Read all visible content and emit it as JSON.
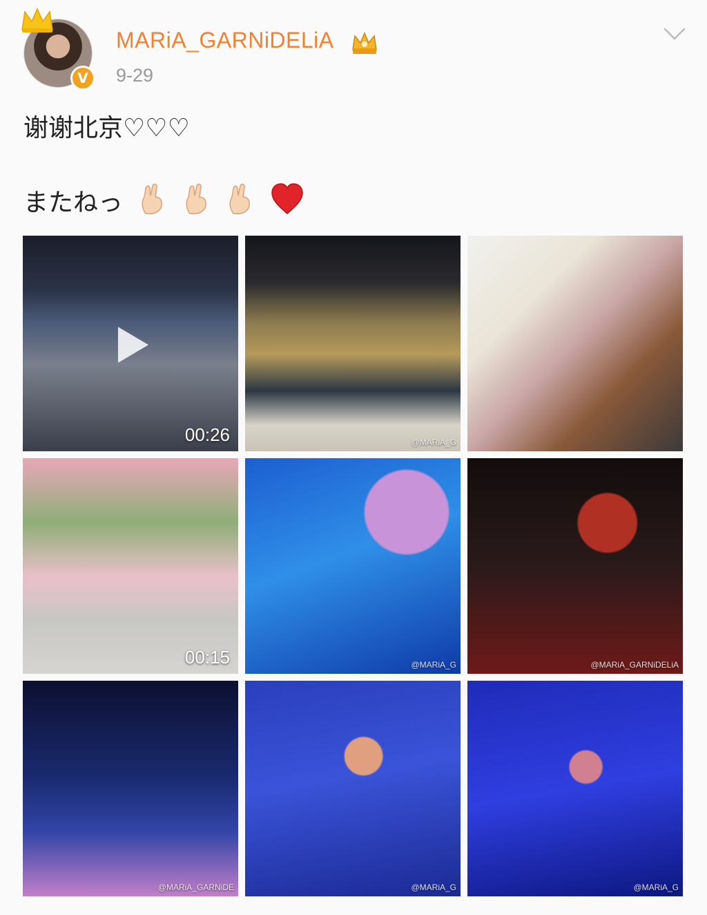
{
  "user": {
    "name": "MARiA_GARNiDELiA",
    "date": "9-29",
    "verified_badge": "V"
  },
  "post": {
    "line1_text": "谢谢北京",
    "line1_hearts": "♡♡♡",
    "line2_text": "またねっ"
  },
  "icons": {
    "avatar": "avatar-photo",
    "crown": "crown-icon",
    "vip": "vip-crown-badge-icon",
    "more": "chevron-down-icon",
    "hand": "crossed-fingers-emoji",
    "heart": "red-heart-emoji",
    "play": "play-icon"
  },
  "colors": {
    "username": "#f08232",
    "date": "#999999",
    "verified": "#f3a21f",
    "heart": "#e0242a"
  },
  "media": [
    {
      "kind": "video",
      "duration": "00:26",
      "watermark": ""
    },
    {
      "kind": "image",
      "duration": "",
      "watermark": "@MARiA_G"
    },
    {
      "kind": "image",
      "duration": "",
      "watermark": ""
    },
    {
      "kind": "video",
      "duration": "00:15",
      "watermark": ""
    },
    {
      "kind": "image",
      "duration": "",
      "watermark": "@MARiA_G"
    },
    {
      "kind": "image",
      "duration": "",
      "watermark": "@MARiA_GARNiDELiA"
    },
    {
      "kind": "image",
      "duration": "",
      "watermark": "@MARiA_GARNiDE"
    },
    {
      "kind": "image",
      "duration": "",
      "watermark": "@MARiA_G"
    },
    {
      "kind": "image",
      "duration": "",
      "watermark": "@MARiA_G"
    }
  ]
}
